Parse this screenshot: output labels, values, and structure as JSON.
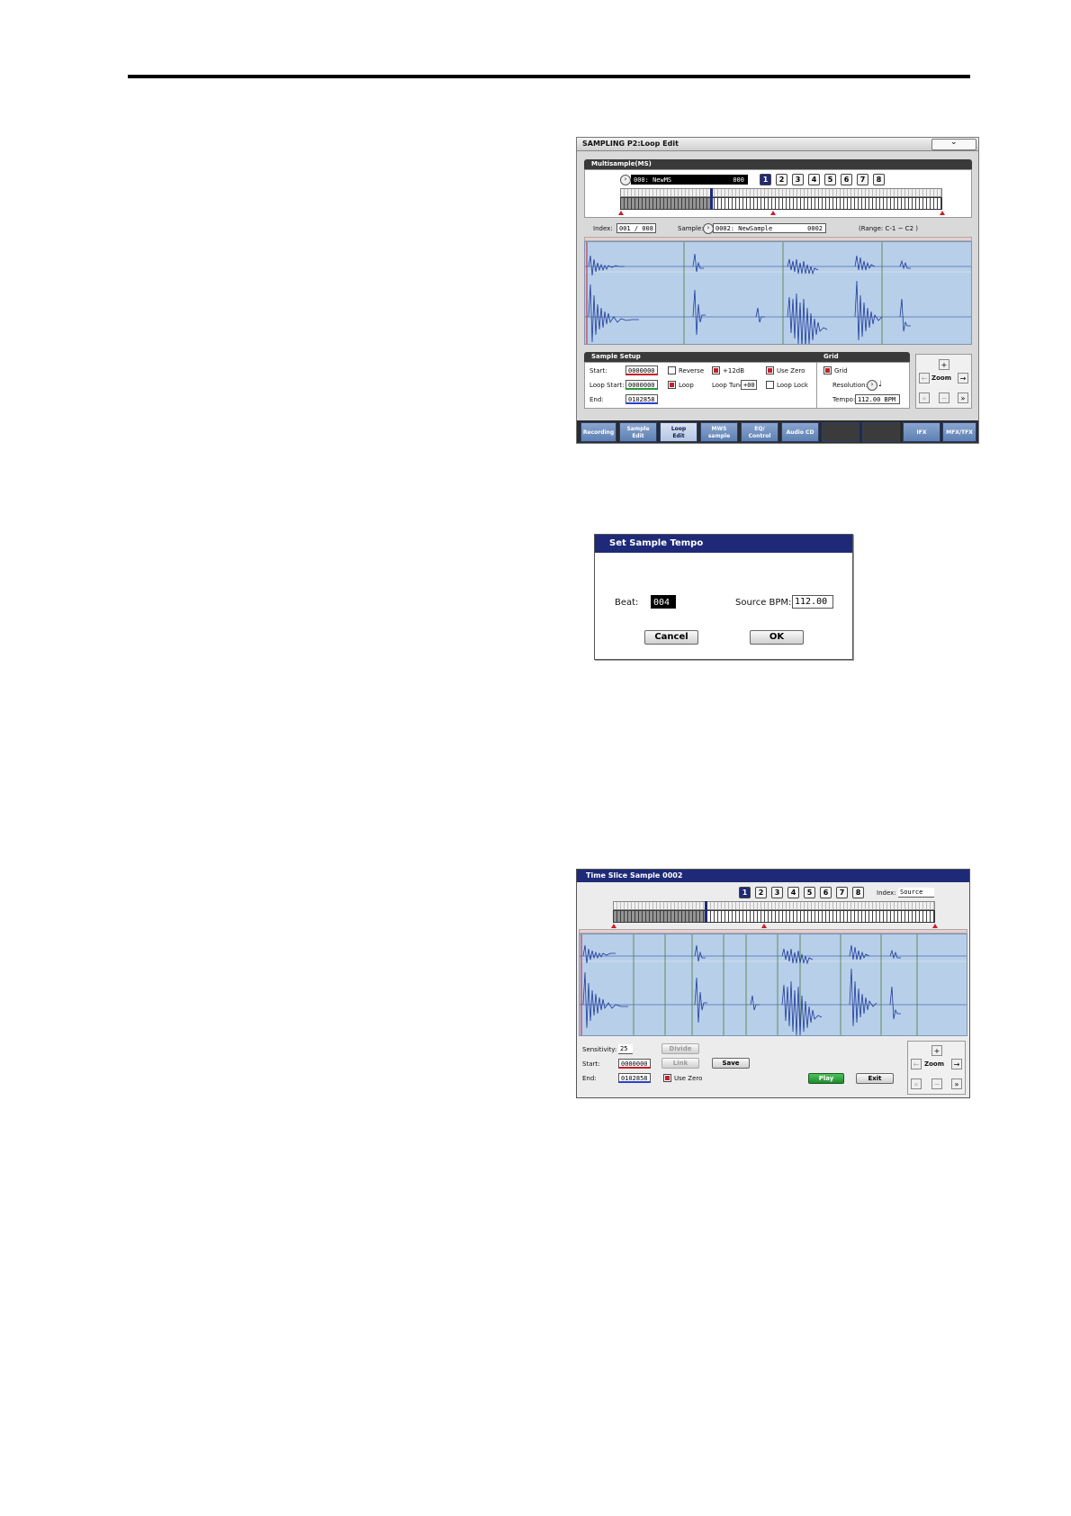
{
  "panel1": {
    "title": "SAMPLING P2:Loop Edit",
    "multisample_header": "Multisample(MS)",
    "ms_name": "000: NewMS",
    "ms_count": "000",
    "ms_buttons": [
      "1",
      "2",
      "3",
      "4",
      "5",
      "6",
      "7",
      "8"
    ],
    "index_label": "Index:",
    "index_value": "001 / 008",
    "sample_label": "Sample:",
    "sample_name": "0002: NewSample",
    "sample_num": "0002",
    "range_text": "(Range: C-1  ~ C2    )",
    "sample_setup_header": "Sample Setup",
    "start_label": "Start:",
    "start_value": "0000000",
    "loop_start_label": "Loop Start:",
    "loop_start_value": "0000000",
    "end_label": "End:",
    "end_value": "0102858",
    "reverse_label": "Reverse",
    "plus12db_label": "+12dB",
    "use_zero_label": "Use Zero",
    "loop_label": "Loop",
    "loop_tune_label": "Loop Tune:",
    "loop_tune_value": "+00",
    "loop_lock_label": "Loop Lock",
    "grid_header": "Grid",
    "grid_label": "Grid",
    "resolution_label": "Resolution:",
    "resolution_value": "♩",
    "tempo_label": "Tempo:",
    "tempo_value": "112.00 BPM",
    "zoom_label": "Zoom",
    "tabs": [
      {
        "l1": "Recording",
        "l2": ""
      },
      {
        "l1": "Sample",
        "l2": "Edit"
      },
      {
        "l1": "Loop",
        "l2": "Edit"
      },
      {
        "l1": "MWS",
        "l2": "sample"
      },
      {
        "l1": "EQ/",
        "l2": "Control"
      },
      {
        "l1": "Audio CD",
        "l2": ""
      },
      {
        "l1": "",
        "l2": ""
      },
      {
        "l1": "",
        "l2": ""
      },
      {
        "l1": "IFX",
        "l2": ""
      },
      {
        "l1": "MFX/TFX",
        "l2": ""
      }
    ]
  },
  "panel2": {
    "title": "Set Sample Tempo",
    "beat_label": "Beat:",
    "beat_value": "004",
    "bpm_label": "Source BPM:",
    "bpm_value": "112.00",
    "cancel_label": "Cancel",
    "ok_label": "OK"
  },
  "panel3": {
    "title": "Time Slice Sample 0002",
    "buttons": [
      "1",
      "2",
      "3",
      "4",
      "5",
      "6",
      "7",
      "8"
    ],
    "index_label": "Index:",
    "index_value": "Source",
    "sensitivity_label": "Sensitivity:",
    "sensitivity_value": "25",
    "divide_label": "Divide",
    "start_label": "Start:",
    "start_value": "0000000",
    "link_label": "Link",
    "save_label": "Save",
    "end_label": "End:",
    "end_value": "0102858",
    "use_zero_label": "Use Zero",
    "play_label": "Play",
    "exit_label": "Exit",
    "zoom_label": "Zoom"
  }
}
